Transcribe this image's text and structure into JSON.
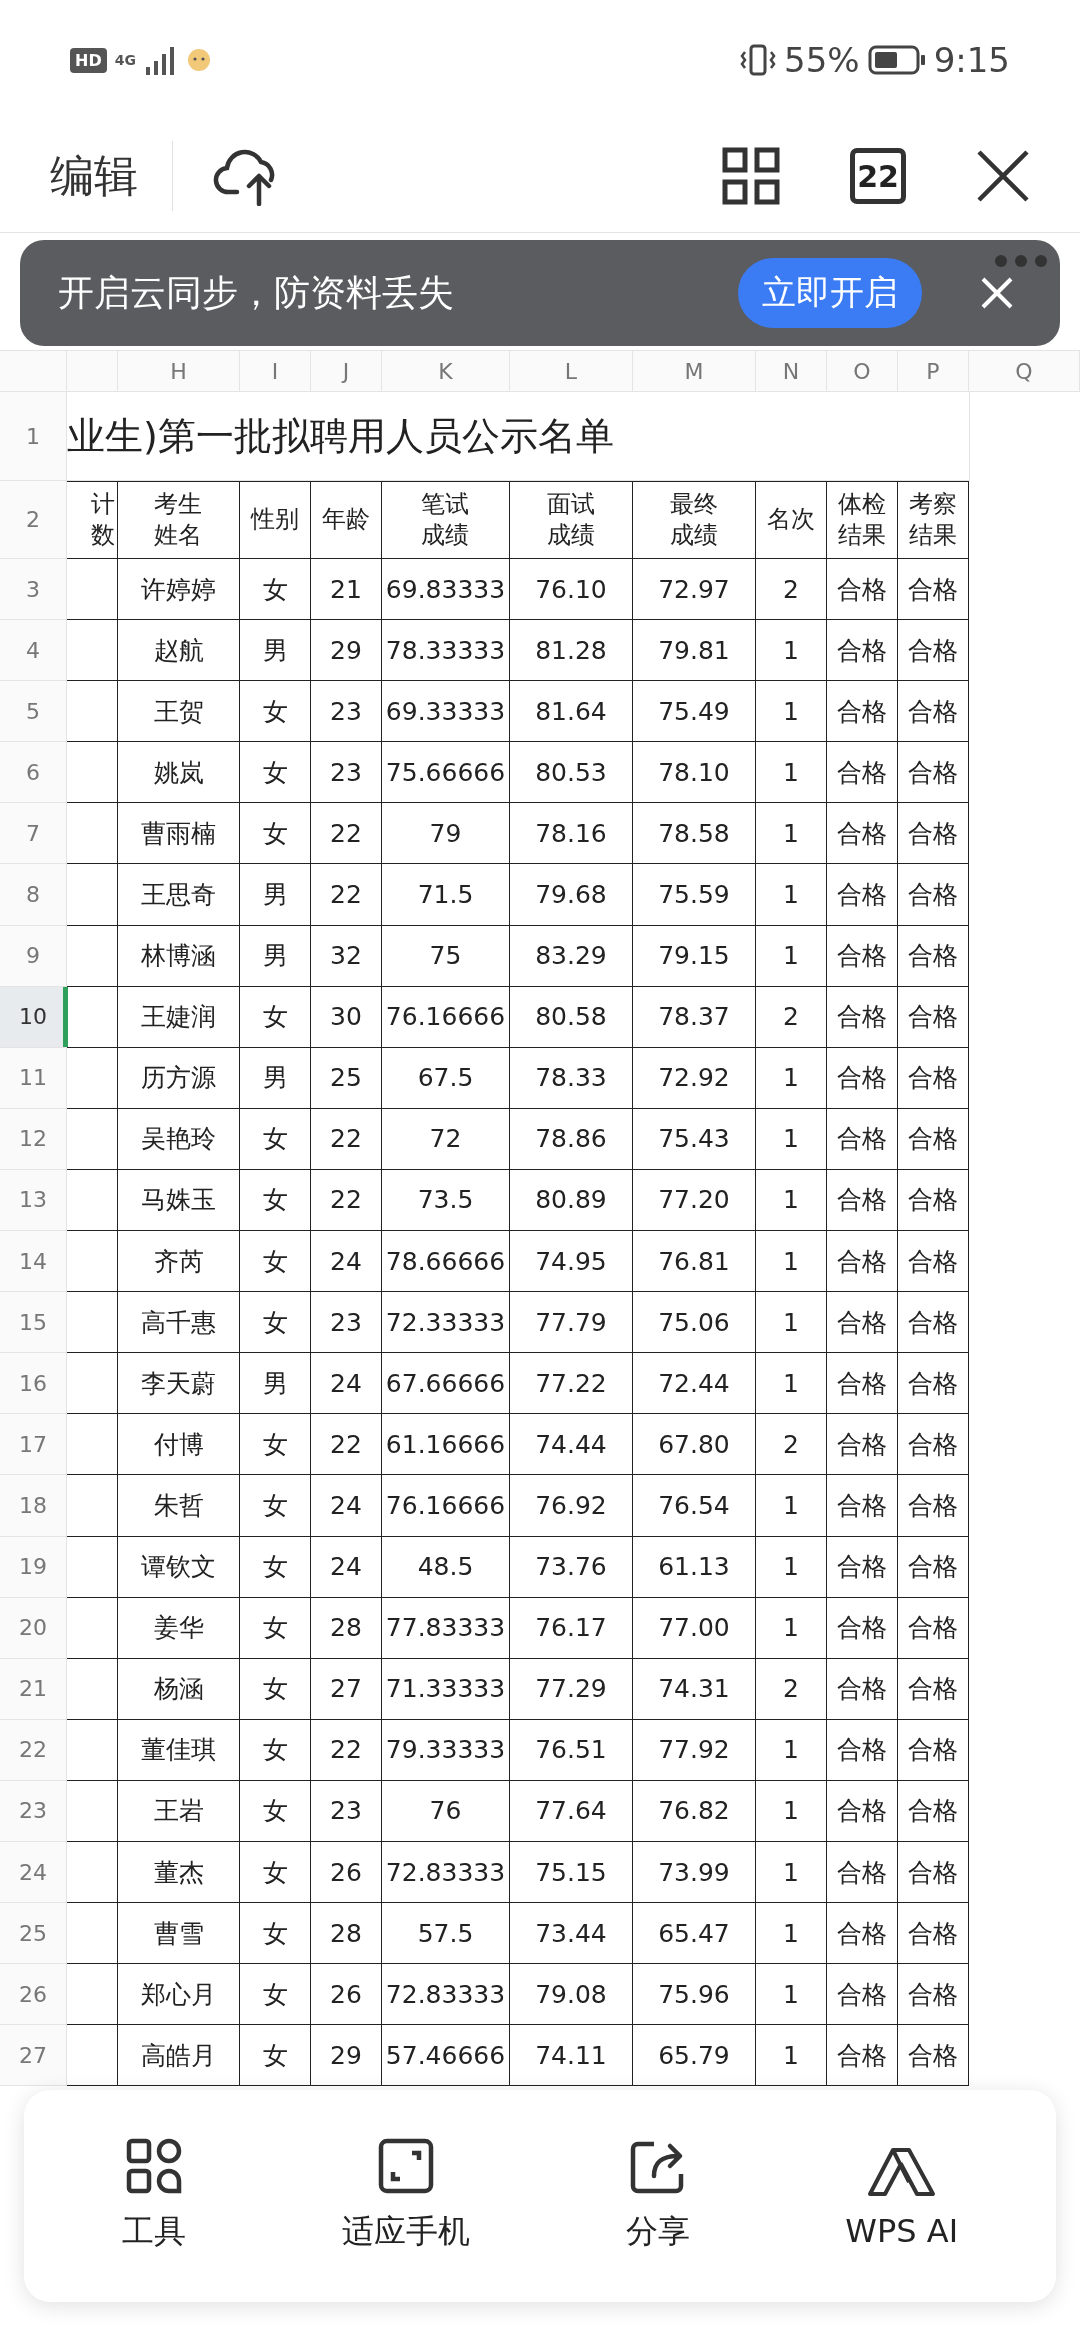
{
  "status_bar": {
    "hd": "HD",
    "network": "4G",
    "battery": "55%",
    "time": "9:15"
  },
  "toolbar": {
    "edit": "编辑",
    "tab_count": "22"
  },
  "banner": {
    "text": "开启云同步，防资料丢失",
    "button": "立即开启"
  },
  "column_letters": [
    "H",
    "I",
    "J",
    "K",
    "L",
    "M",
    "N",
    "O",
    "P",
    "Q"
  ],
  "title_row": {
    "num": "1",
    "text": "业生)第一批拟聘用人员公示名单"
  },
  "header_row": {
    "num": "2",
    "column_g": "计数",
    "headers": [
      "考生姓名",
      "性别",
      "年龄",
      "笔试成绩",
      "面试成绩",
      "最终成绩",
      "名次",
      "体检结果",
      "考察结果"
    ]
  },
  "table": {
    "rows": [
      {
        "num": "3",
        "selected": false,
        "cells": [
          "许婷婷",
          "女",
          "21",
          "69.83333",
          "76.10",
          "72.97",
          "2",
          "合格",
          "合格"
        ]
      },
      {
        "num": "4",
        "selected": false,
        "cells": [
          "赵航",
          "男",
          "29",
          "78.33333",
          "81.28",
          "79.81",
          "1",
          "合格",
          "合格"
        ]
      },
      {
        "num": "5",
        "selected": false,
        "cells": [
          "王贺",
          "女",
          "23",
          "69.33333",
          "81.64",
          "75.49",
          "1",
          "合格",
          "合格"
        ]
      },
      {
        "num": "6",
        "selected": false,
        "cells": [
          "姚岚",
          "女",
          "23",
          "75.66666",
          "80.53",
          "78.10",
          "1",
          "合格",
          "合格"
        ]
      },
      {
        "num": "7",
        "selected": false,
        "cells": [
          "曹雨楠",
          "女",
          "22",
          "79",
          "78.16",
          "78.58",
          "1",
          "合格",
          "合格"
        ]
      },
      {
        "num": "8",
        "selected": false,
        "cells": [
          "王思奇",
          "男",
          "22",
          "71.5",
          "79.68",
          "75.59",
          "1",
          "合格",
          "合格"
        ]
      },
      {
        "num": "9",
        "selected": false,
        "cells": [
          "林博涵",
          "男",
          "32",
          "75",
          "83.29",
          "79.15",
          "1",
          "合格",
          "合格"
        ]
      },
      {
        "num": "10",
        "selected": true,
        "cells": [
          "王婕润",
          "女",
          "30",
          "76.16666",
          "80.58",
          "78.37",
          "2",
          "合格",
          "合格"
        ]
      },
      {
        "num": "11",
        "selected": false,
        "cells": [
          "历方源",
          "男",
          "25",
          "67.5",
          "78.33",
          "72.92",
          "1",
          "合格",
          "合格"
        ]
      },
      {
        "num": "12",
        "selected": false,
        "cells": [
          "吴艳玲",
          "女",
          "22",
          "72",
          "78.86",
          "75.43",
          "1",
          "合格",
          "合格"
        ]
      },
      {
        "num": "13",
        "selected": false,
        "cells": [
          "马姝玉",
          "女",
          "22",
          "73.5",
          "80.89",
          "77.20",
          "1",
          "合格",
          "合格"
        ]
      },
      {
        "num": "14",
        "selected": false,
        "cells": [
          "齐芮",
          "女",
          "24",
          "78.66666",
          "74.95",
          "76.81",
          "1",
          "合格",
          "合格"
        ]
      },
      {
        "num": "15",
        "selected": false,
        "cells": [
          "高千惠",
          "女",
          "23",
          "72.33333",
          "77.79",
          "75.06",
          "1",
          "合格",
          "合格"
        ]
      },
      {
        "num": "16",
        "selected": false,
        "cells": [
          "李天蔚",
          "男",
          "24",
          "67.66666",
          "77.22",
          "72.44",
          "1",
          "合格",
          "合格"
        ]
      },
      {
        "num": "17",
        "selected": false,
        "cells": [
          "付博",
          "女",
          "22",
          "61.16666",
          "74.44",
          "67.80",
          "2",
          "合格",
          "合格"
        ]
      },
      {
        "num": "18",
        "selected": false,
        "cells": [
          "朱哲",
          "女",
          "24",
          "76.16666",
          "76.92",
          "76.54",
          "1",
          "合格",
          "合格"
        ]
      },
      {
        "num": "19",
        "selected": false,
        "cells": [
          "谭钦文",
          "女",
          "24",
          "48.5",
          "73.76",
          "61.13",
          "1",
          "合格",
          "合格"
        ]
      },
      {
        "num": "20",
        "selected": false,
        "cells": [
          "姜华",
          "女",
          "28",
          "77.83333",
          "76.17",
          "77.00",
          "1",
          "合格",
          "合格"
        ]
      },
      {
        "num": "21",
        "selected": false,
        "cells": [
          "杨涵",
          "女",
          "27",
          "71.33333",
          "77.29",
          "74.31",
          "2",
          "合格",
          "合格"
        ]
      },
      {
        "num": "22",
        "selected": false,
        "cells": [
          "董佳琪",
          "女",
          "22",
          "79.33333",
          "76.51",
          "77.92",
          "1",
          "合格",
          "合格"
        ]
      },
      {
        "num": "23",
        "selected": false,
        "cells": [
          "王岩",
          "女",
          "23",
          "76",
          "77.64",
          "76.82",
          "1",
          "合格",
          "合格"
        ]
      },
      {
        "num": "24",
        "selected": false,
        "cells": [
          "董杰",
          "女",
          "26",
          "72.83333",
          "75.15",
          "73.99",
          "1",
          "合格",
          "合格"
        ]
      },
      {
        "num": "25",
        "selected": false,
        "cells": [
          "曹雪",
          "女",
          "28",
          "57.5",
          "73.44",
          "65.47",
          "1",
          "合格",
          "合格"
        ]
      },
      {
        "num": "26",
        "selected": false,
        "cells": [
          "郑心月",
          "女",
          "26",
          "72.83333",
          "79.08",
          "75.96",
          "1",
          "合格",
          "合格"
        ]
      },
      {
        "num": "27",
        "selected": false,
        "cells": [
          "高皓月",
          "女",
          "29",
          "57.46666",
          "74.11",
          "65.79",
          "1",
          "合格",
          "合格"
        ]
      }
    ]
  },
  "bottom_bar": [
    {
      "kind": "tools",
      "label": "工具"
    },
    {
      "kind": "fit",
      "label": "适应手机"
    },
    {
      "kind": "share",
      "label": "分享"
    },
    {
      "kind": "ai",
      "label": "WPS AI"
    }
  ]
}
